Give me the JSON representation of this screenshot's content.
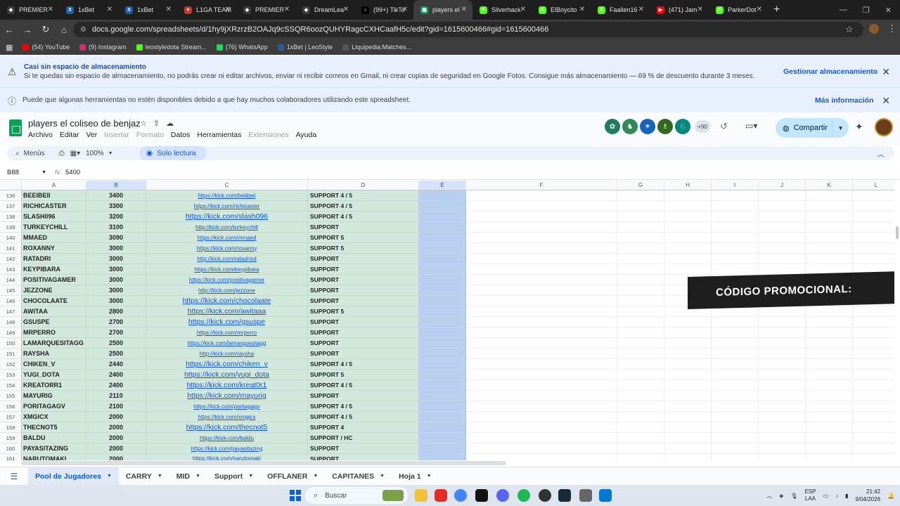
{
  "browser": {
    "tabs": [
      {
        "label": "PREMIER",
        "color": "#3c3c3c",
        "glyph": "◆"
      },
      {
        "label": "1xBet",
        "color": "#1e5faa",
        "glyph": "X"
      },
      {
        "label": "1xBet",
        "color": "#1e5faa",
        "glyph": "X"
      },
      {
        "label": "L1GA TEAM",
        "color": "#c0392b",
        "glyph": "♥"
      },
      {
        "label": "PREMIER",
        "color": "#3c3c3c",
        "glyph": "◆"
      },
      {
        "label": "DreamLea",
        "color": "#3c3c3c",
        "glyph": "◆"
      },
      {
        "label": "(99+) TikTo",
        "color": "#000000",
        "glyph": "♪"
      },
      {
        "label": "players el",
        "color": "#0f9d58",
        "glyph": "▦"
      },
      {
        "label": "Silverhack",
        "color": "#53fc18",
        "glyph": "K"
      },
      {
        "label": "ElBoycito",
        "color": "#53fc18",
        "glyph": "K"
      },
      {
        "label": "Faallen16",
        "color": "#53fc18",
        "glyph": "K"
      },
      {
        "label": "(471) Jam",
        "color": "#ff0000",
        "glyph": "▶"
      },
      {
        "label": "ParkerDot",
        "color": "#53fc18",
        "glyph": "K"
      }
    ],
    "url": "docs.google.com/spreadsheets/d/1hy9jXRzrzB2OAJq9cSSQR6oozQUHYRagcCXHCaafH5c/edit?gid=1615600466#gid=1615600466",
    "bookmarks": [
      {
        "label": "(54) YouTube",
        "color": "#ff0000"
      },
      {
        "label": "(9) Instagram",
        "color": "#d62976"
      },
      {
        "label": "leostyledota Stream...",
        "color": "#53fc18"
      },
      {
        "label": "(76) WhatsApp",
        "color": "#25d366"
      },
      {
        "label": "1xBet | LeoStyle",
        "color": "#1e5faa"
      },
      {
        "label": "Liquipedia:Matches...",
        "color": "#555555"
      }
    ]
  },
  "banners": {
    "storage_title": "Casi sin espacio de almacenamiento",
    "storage_text": "Si te quedas sin espacio de almacenamiento, no podrás crear ni editar archivos, enviar ni recibir correos en Gmail, ni crear copias de seguridad en Google Fotos. Consigue más almacenamiento — 69 % de descuento durante 3 meses.",
    "storage_link": "Gestionar almacenamiento",
    "collab_text": "Puede que algunas herramientas no estén disponibles debido a que hay muchos colaboradores utilizando este spreadsheet.",
    "collab_link": "Más información"
  },
  "doc": {
    "title": "players el coliseo de benjaz",
    "menus": [
      "Archivo",
      "Editar",
      "Ver",
      "Insertar",
      "Formato",
      "Datos",
      "Herramientas",
      "Extensiones",
      "Ayuda"
    ],
    "disabled_menus": [
      "Insertar",
      "Formato",
      "Extensiones"
    ],
    "more_collaborators": "+90",
    "share_label": "Compartir"
  },
  "toolbar": {
    "menus_label": "Menús",
    "zoom": "100%",
    "readonly_label": "Solo lectura"
  },
  "formula": {
    "cell_ref": "B88",
    "fx": "fx",
    "value": "5400"
  },
  "columns": [
    "A",
    "B",
    "C",
    "D",
    "E",
    "F",
    "G",
    "H",
    "I",
    "J",
    "K",
    "L"
  ],
  "rows": [
    {
      "n": "136",
      "a": "BEEIBEII",
      "b": "3400",
      "c": "https://kick.com/beiibeii",
      "d": "SUPPORT 4 / 5",
      "big": false
    },
    {
      "n": "137",
      "a": "RICHICASTER",
      "b": "3300",
      "c": "https://kick.com/richicaster",
      "d": "SUPPORT 4 / 5",
      "big": false
    },
    {
      "n": "138",
      "a": "SLASH096",
      "b": "3200",
      "c": "https://kick.com/slash096",
      "d": "SUPPORT 4 / 5",
      "big": true
    },
    {
      "n": "139",
      "a": "TURKEYCHILL",
      "b": "3100",
      "c": "http://kick.com/turkeychill",
      "d": "SUPPORT",
      "big": false
    },
    {
      "n": "140",
      "a": "MMAED",
      "b": "3090",
      "c": "https://kick.com/mmaed",
      "d": "SUPPORT 5",
      "big": false
    },
    {
      "n": "141",
      "a": "ROXANNY",
      "b": "3000",
      "c": "https://kick.com/roxanny",
      "d": "SUPPORT 5",
      "big": false
    },
    {
      "n": "142",
      "a": "RATADRI",
      "b": "3000",
      "c": "http://kick.com/ratadrixd",
      "d": "SUPPORT",
      "big": false
    },
    {
      "n": "143",
      "a": "KEYPIBARA",
      "b": "3000",
      "c": "https://kick.com/keypibara",
      "d": "SUPPORT",
      "big": false
    },
    {
      "n": "144",
      "a": "POSITIVAGAMER",
      "b": "3000",
      "c": "https://kick.com/positivagamer",
      "d": "SUPPORT",
      "big": false
    },
    {
      "n": "145",
      "a": "JEZZONE",
      "b": "3000",
      "c": "http://kick.com/jezzone",
      "d": "SUPPORT",
      "big": false
    },
    {
      "n": "146",
      "a": "CHOCOLAATE",
      "b": "3000",
      "c": "https://kick.com/chocolaate",
      "d": "SUPPORT",
      "big": true
    },
    {
      "n": "147",
      "a": "AWITAA",
      "b": "2800",
      "c": "https://kick.com/awitaaa",
      "d": "SUPPORT 5",
      "big": true
    },
    {
      "n": "148",
      "a": "GSUSPE",
      "b": "2700",
      "c": "https://kick.com/gsuspe",
      "d": "SUPPORT",
      "big": true
    },
    {
      "n": "149",
      "a": "MRPERRO",
      "b": "2700",
      "c": "https://kick.com/mrperro",
      "d": "SUPPORT",
      "big": false
    },
    {
      "n": "150",
      "a": "LAMARQUESITAGG",
      "b": "2500",
      "c": "https://kick.com/lamarquesitagg",
      "d": "SUPPORT",
      "big": false
    },
    {
      "n": "151",
      "a": "RAYSHA",
      "b": "2500",
      "c": "http://kick.com/raysha",
      "d": "SUPPORT",
      "big": false
    },
    {
      "n": "152",
      "a": "CHIKEN_V",
      "b": "2440",
      "c": "https://kick.com/chiken_v",
      "d": "SUPPORT 4 / 5",
      "big": true
    },
    {
      "n": "153",
      "a": "YUGI_DOTA",
      "b": "2400",
      "c": "https://kick.com/yugi_dota",
      "d": "SUPPORT 5",
      "big": true
    },
    {
      "n": "154",
      "a": "KREATORR1",
      "b": "2400",
      "c": "https://kick.com/kreat0r1",
      "d": "SUPPORT 4 / 5",
      "big": true
    },
    {
      "n": "155",
      "a": "MAYURIG",
      "b": "2110",
      "c": "https://kick.com/mayurig",
      "d": "SUPPORT",
      "big": true
    },
    {
      "n": "156",
      "a": "PORITAGAGV",
      "b": "2100",
      "c": "https://kick.com/poritagagv",
      "d": "SUPPORT 4 / 5",
      "big": false
    },
    {
      "n": "157",
      "a": "XMGICX",
      "b": "2000",
      "c": "https://kick.com/xmgicx",
      "d": "SUPPORT 4 / 5",
      "big": false
    },
    {
      "n": "158",
      "a": "THECNOT5",
      "b": "2000",
      "c": "https://kick.com/thecnot5",
      "d": "SUPPORT 4",
      "big": true
    },
    {
      "n": "159",
      "a": "BALDU",
      "b": "2000",
      "c": "https://kick.com/baldu",
      "d": "SUPPORT / HC",
      "big": false
    },
    {
      "n": "160",
      "a": "PAYASITAZING",
      "b": "2000",
      "c": "https://kick.com/payasitazing",
      "d": "SUPPORT",
      "big": false
    },
    {
      "n": "161",
      "a": "NARUTOMAKI",
      "b": "2000",
      "c": "https://kick.com/narutomaki",
      "d": "SUPPORT",
      "big": false
    }
  ],
  "overlay": {
    "promo_text": "CÓDIGO PROMOCIONAL:"
  },
  "sheet_tabs": [
    "Pool de Jugadores",
    "CARRY",
    "MID",
    "Support",
    "OFFLANER",
    "CAPITANES",
    "Hoja 1"
  ],
  "active_sheet": "Pool de Jugadores",
  "taskbar": {
    "search_placeholder": "Buscar",
    "lang_top": "ESP",
    "lang_bottom": "LAA",
    "time": "21:42",
    "date": "9/04/2026"
  }
}
